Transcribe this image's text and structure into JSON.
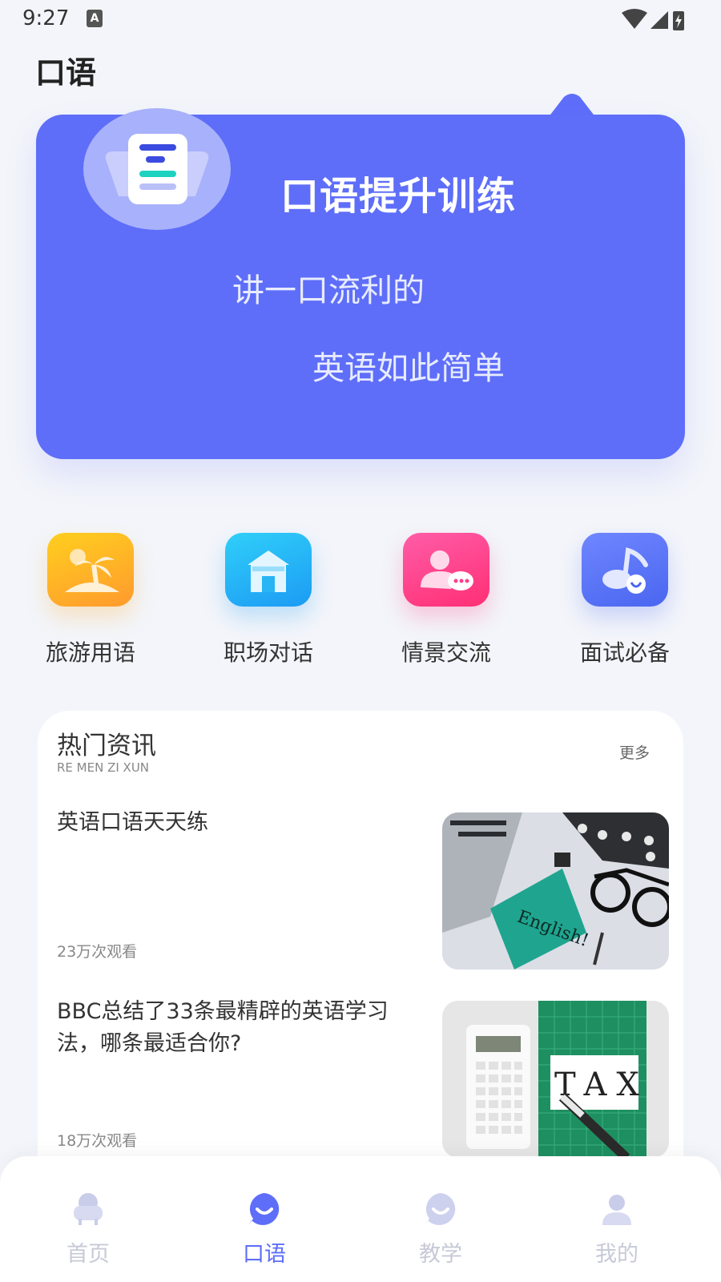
{
  "status_bar": {
    "time": "9:27",
    "indicator": "A"
  },
  "page": {
    "title": "口语"
  },
  "hero": {
    "title": "口语提升训练",
    "line1": "讲一口流利的",
    "line2": "英语如此简单"
  },
  "categories": [
    {
      "label": "旅游用语",
      "icon": "island-icon",
      "color": "#FFB21C"
    },
    {
      "label": "职场对话",
      "icon": "house-icon",
      "color": "#22B3F4"
    },
    {
      "label": "情景交流",
      "icon": "chat-people-icon",
      "color": "#FF3F8C"
    },
    {
      "label": "面试必备",
      "icon": "music-note-icon",
      "color": "#5A73F6"
    }
  ],
  "news": {
    "title": "热门资讯",
    "subtitle": "RE MEN ZI XUN",
    "more": "更多",
    "articles": [
      {
        "title": "英语口语天天练",
        "views": "23万次观看",
        "image_text": "English!"
      },
      {
        "title": "BBC总结了33条最精辟的英语学习法，哪条最适合你?",
        "views": "18万次观看",
        "image_text": "TAX"
      }
    ]
  },
  "tabbar": {
    "tabs": [
      {
        "label": "首页",
        "icon": "armchair-icon",
        "active": false
      },
      {
        "label": "口语",
        "icon": "smile-bubble-icon",
        "active": true
      },
      {
        "label": "教学",
        "icon": "smile-bubble-icon",
        "active": false
      },
      {
        "label": "我的",
        "icon": "person-icon",
        "active": false
      }
    ]
  }
}
